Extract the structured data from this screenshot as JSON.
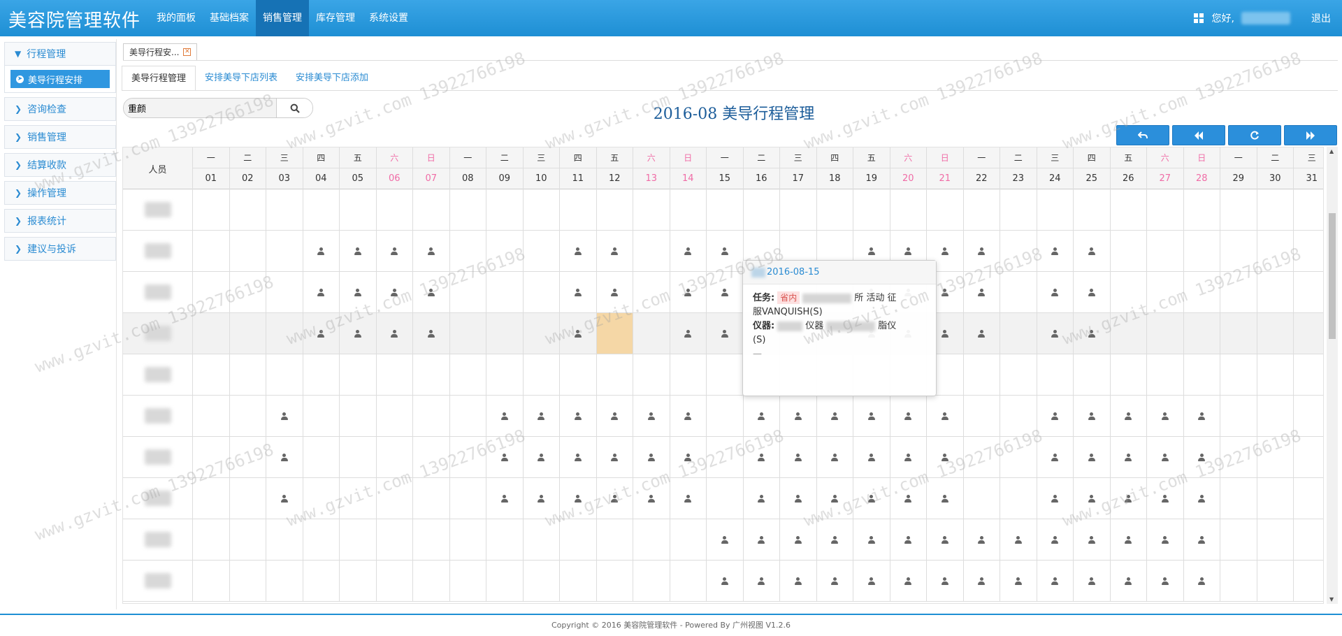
{
  "app": {
    "title": "美容院管理软件"
  },
  "topnav": [
    {
      "label": "我的面板",
      "active": false
    },
    {
      "label": "基础档案",
      "active": false
    },
    {
      "label": "销售管理",
      "active": true
    },
    {
      "label": "库存管理",
      "active": false
    },
    {
      "label": "系统设置",
      "active": false
    }
  ],
  "user": {
    "greeting": "您好,",
    "logout": "退出"
  },
  "sidebar": {
    "items": [
      {
        "label": "行程管理",
        "expanded": true,
        "children": [
          {
            "label": "美导行程安排",
            "active": true
          }
        ]
      },
      {
        "label": "咨询检查"
      },
      {
        "label": "销售管理"
      },
      {
        "label": "结算收款"
      },
      {
        "label": "操作管理"
      },
      {
        "label": "报表统计"
      },
      {
        "label": "建议与投诉"
      }
    ]
  },
  "doc_tab": {
    "label": "美导行程安..."
  },
  "subtabs": [
    {
      "label": "美导行程管理",
      "active": true
    },
    {
      "label": "安排美导下店列表",
      "active": false
    },
    {
      "label": "安排美导下店添加",
      "active": false
    }
  ],
  "search": {
    "value": "重颜"
  },
  "page_title": "2016-08  美导行程管理",
  "calendar": {
    "person_header": "人员",
    "weekdays": [
      "一",
      "二",
      "三",
      "四",
      "五",
      "六",
      "日",
      "一",
      "二",
      "三",
      "四",
      "五",
      "六",
      "日",
      "一",
      "二",
      "三",
      "四",
      "五",
      "六",
      "日",
      "一",
      "二",
      "三",
      "四",
      "五",
      "六",
      "日",
      "一",
      "二",
      "三"
    ],
    "dates": [
      "01",
      "02",
      "03",
      "04",
      "05",
      "06",
      "07",
      "08",
      "09",
      "10",
      "11",
      "12",
      "13",
      "14",
      "15",
      "16",
      "17",
      "18",
      "19",
      "20",
      "21",
      "22",
      "23",
      "24",
      "25",
      "26",
      "27",
      "28",
      "29",
      "30",
      "31"
    ],
    "weekend_days": [
      6,
      7,
      13,
      14,
      20,
      21,
      27,
      28
    ],
    "selected": {
      "row": 3,
      "day": 12
    },
    "highlight_row": 3,
    "rows": [
      {
        "marks": []
      },
      {
        "marks": [
          4,
          5,
          6,
          7,
          11,
          12,
          14,
          15,
          19,
          20,
          21,
          22,
          24,
          25
        ]
      },
      {
        "marks": [
          4,
          5,
          6,
          7,
          11,
          12,
          14,
          15,
          19,
          20,
          21,
          22,
          24,
          25
        ]
      },
      {
        "marks": [
          4,
          5,
          6,
          7,
          11,
          14,
          15,
          19,
          20,
          21,
          22,
          24,
          25
        ]
      },
      {
        "marks": []
      },
      {
        "marks": [
          3,
          9,
          10,
          11,
          12,
          13,
          14,
          16,
          17,
          18,
          19,
          20,
          21,
          24,
          25,
          26,
          27,
          28
        ]
      },
      {
        "marks": [
          3,
          9,
          10,
          11,
          12,
          13,
          14,
          16,
          17,
          18,
          19,
          20,
          21,
          24,
          25,
          26,
          27,
          28
        ]
      },
      {
        "marks": [
          3,
          9,
          10,
          11,
          12,
          13,
          14,
          16,
          17,
          18,
          19,
          20,
          21,
          24,
          25,
          26,
          27,
          28
        ]
      },
      {
        "marks": [
          15,
          16,
          17,
          18,
          19,
          20,
          21,
          22,
          23,
          24,
          25,
          26,
          27,
          28
        ]
      },
      {
        "marks": [
          15,
          16,
          17,
          18,
          19,
          20,
          21,
          22,
          23,
          24,
          25,
          26,
          27,
          28
        ]
      }
    ]
  },
  "popover": {
    "date": "2016-08-15",
    "task_label": "任务:",
    "task_tag": "省内",
    "task_text_1": "所 活动 征",
    "task_text_2": "服VANQUISH(S)",
    "instrument_label": "仪器:",
    "instrument_text_1": "仪器",
    "instrument_text_2": "脂仪",
    "instrument_text_3": "(S)",
    "extra": "—"
  },
  "footer": {
    "text": "Copyright © 2016 美容院管理软件 - Powered By 广州视图 V1.2.6"
  },
  "watermark": {
    "text": "www.gzvit.com  13922766198"
  },
  "colors": {
    "accent": "#1e8fd4",
    "weekend": "#f06ca6",
    "selected_cell": "#f5d7a6"
  }
}
